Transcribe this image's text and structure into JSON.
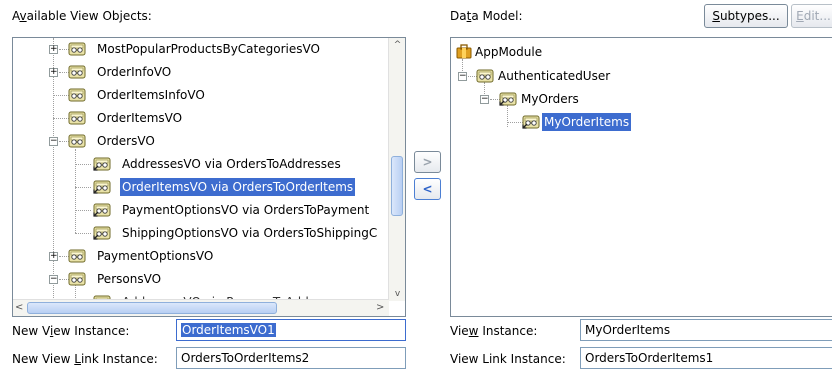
{
  "left": {
    "title_pre": "A",
    "title_u": "v",
    "title_post": "ailable View Objects:",
    "tree": [
      {
        "label": "MostPopularProductsByCategoriesVO",
        "toggle": "+"
      },
      {
        "label": "OrderInfoVO",
        "toggle": "+"
      },
      {
        "label": "OrderItemsInfoVO",
        "toggle": ""
      },
      {
        "label": "OrderItemsVO",
        "toggle": ""
      },
      {
        "label": "OrdersVO",
        "toggle": "−"
      },
      {
        "label": "AddressesVO via OrdersToAddresses",
        "toggle": ""
      },
      {
        "label": "OrderItemsVO via OrdersToOrderItems",
        "toggle": "",
        "selected": true
      },
      {
        "label": "PaymentOptionsVO via OrdersToPayment",
        "toggle": ""
      },
      {
        "label": "ShippingOptionsVO via OrdersToShippingC",
        "toggle": ""
      },
      {
        "label": "PaymentOptionsVO",
        "toggle": "+"
      },
      {
        "label": "PersonsVO",
        "toggle": "−"
      },
      {
        "label": "AddressesVO via PersonsToAddr...",
        "toggle": ""
      }
    ],
    "new_view_instance_label_pre": "New V",
    "new_view_instance_label_u": "i",
    "new_view_instance_label_post": "ew Instance:",
    "new_view_instance_value": "OrderItemsVO1",
    "new_view_link_label_pre": "New View ",
    "new_view_link_label_u": "L",
    "new_view_link_label_post": "ink Instance:",
    "new_view_link_value": "OrdersToOrderItems2"
  },
  "shuttle": {
    "add_glyph": ">",
    "remove_glyph": "<"
  },
  "right": {
    "title_pre": "Da",
    "title_u": "t",
    "title_post": "a Model:",
    "subtypes_u": "S",
    "subtypes_rest": "ubtypes...",
    "edit_u": "E",
    "edit_rest": "dit...",
    "tree": [
      {
        "label": "AppModule"
      },
      {
        "label": "AuthenticatedUser"
      },
      {
        "label": "MyOrders"
      },
      {
        "label": "MyOrderItems",
        "selected": true
      }
    ],
    "view_instance_label_pre": "Vie",
    "view_instance_label_u": "w",
    "view_instance_label_post": " Instance:",
    "view_instance_value": "MyOrderItems",
    "view_link_label": "View Link Instance:",
    "view_link_value": "OrdersToOrderItems1"
  },
  "colors": {
    "selection": "#3d6ccf",
    "border": "#7a8a99",
    "disabled_text": "#a0a8b4"
  }
}
